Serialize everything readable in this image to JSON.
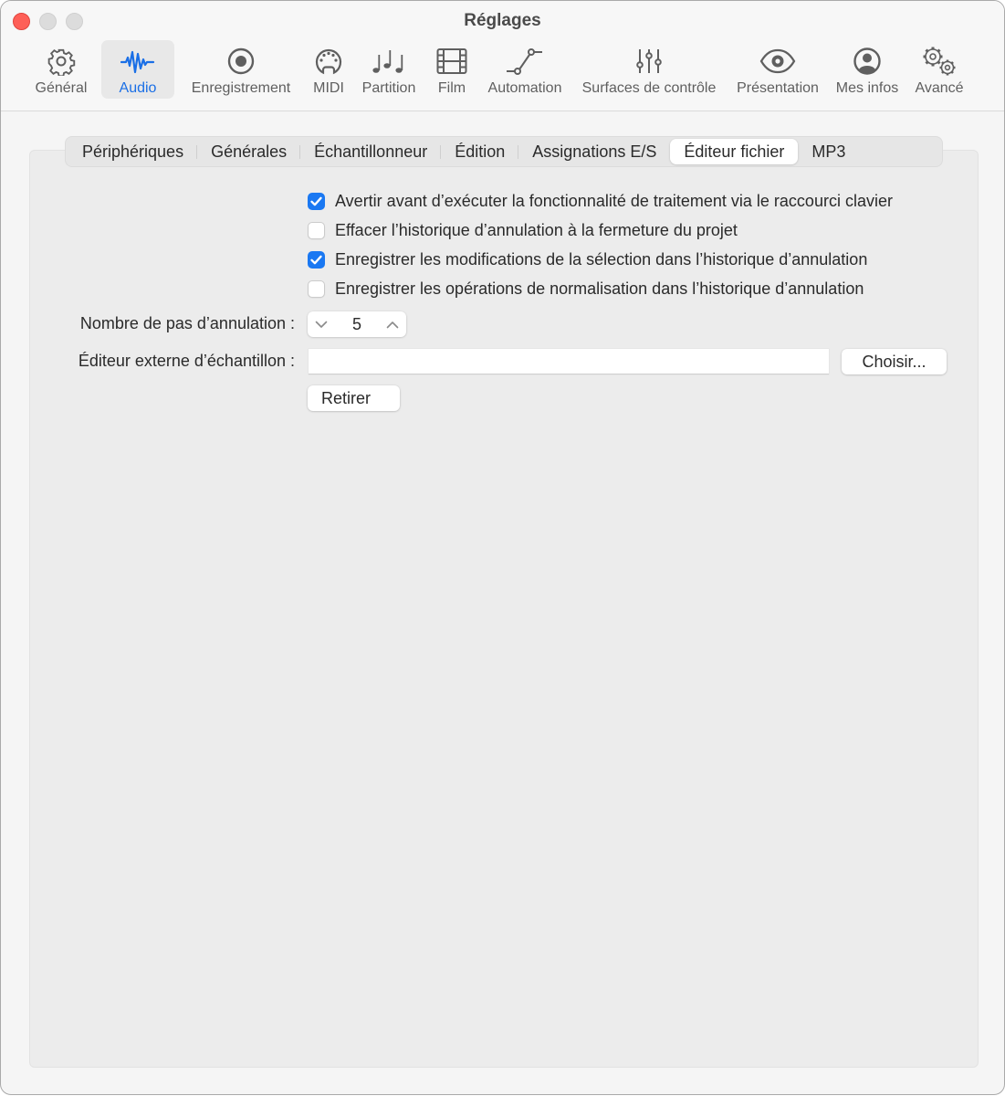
{
  "window": {
    "title": "Réglages",
    "traffic_lights": [
      "close",
      "minimize",
      "zoom"
    ]
  },
  "toolbar": {
    "items": [
      {
        "label": "Général",
        "icon": "gear-icon",
        "active": false
      },
      {
        "label": "Audio",
        "icon": "waveform-icon",
        "active": true
      },
      {
        "label": "Enregistrement",
        "icon": "record-icon",
        "active": false
      },
      {
        "label": "MIDI",
        "icon": "midi-connector-icon",
        "active": false
      },
      {
        "label": "Partition",
        "icon": "music-notes-icon",
        "active": false
      },
      {
        "label": "Film",
        "icon": "film-icon",
        "active": false
      },
      {
        "label": "Automation",
        "icon": "automation-curve-icon",
        "active": false
      },
      {
        "label": "Surfaces de contrôle",
        "icon": "sliders-icon",
        "active": false
      },
      {
        "label": "Présentation",
        "icon": "eye-icon",
        "active": false
      },
      {
        "label": "Mes infos",
        "icon": "person-circle-icon",
        "active": false
      },
      {
        "label": "Avancé",
        "icon": "gears-icon",
        "active": false
      }
    ],
    "accent_color": "#1a6fe6"
  },
  "tabs": [
    {
      "label": "Périphériques",
      "active": false
    },
    {
      "label": "Générales",
      "active": false
    },
    {
      "label": "Échantillonneur",
      "active": false
    },
    {
      "label": "Édition",
      "active": false
    },
    {
      "label": "Assignations E/S",
      "active": false
    },
    {
      "label": "Éditeur fichier",
      "active": true
    },
    {
      "label": "MP3",
      "active": false
    }
  ],
  "options": [
    {
      "label": "Avertir avant d’exécuter la fonctionnalité de traitement via le raccourci clavier",
      "checked": true
    },
    {
      "label": "Effacer l’historique d’annulation à la fermeture du projet",
      "checked": false
    },
    {
      "label": "Enregistrer les modifications de la sélection dans l’historique d’annulation",
      "checked": true
    },
    {
      "label": "Enregistrer les opérations de normalisation dans l’historique d’annulation",
      "checked": false
    }
  ],
  "undo_steps": {
    "label": "Nombre de pas d’annulation :",
    "value": "5"
  },
  "external_editor": {
    "label": "Éditeur externe d’échantillon :",
    "value": "",
    "choose_label": "Choisir...",
    "remove_label": "Retirer"
  },
  "colors": {
    "checkbox_on": "#1a78f2",
    "close_button": "#fe5f57"
  }
}
